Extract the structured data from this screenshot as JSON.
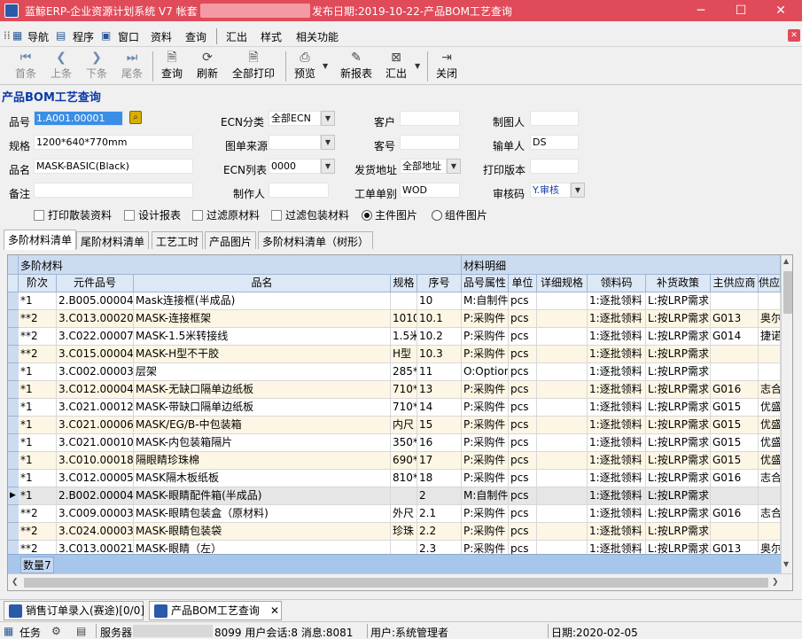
{
  "window": {
    "title_left": "蓝鲸ERP-企业资源计划系统 V7 帐套",
    "title_right": "发布日期:2019-10-22-产品BOM工艺查询",
    "minimize": "─",
    "maximize": "☐",
    "close": "✕"
  },
  "menu": {
    "items": [
      "导航",
      "程序",
      "窗口",
      "资料",
      "查询",
      "汇出",
      "样式",
      "相关功能"
    ]
  },
  "toolbar": {
    "first": "首条",
    "prev": "上条",
    "next": "下条",
    "last": "尾条",
    "query": "查询",
    "refresh": "刷新",
    "print_all": "全部打印",
    "preview": "预览",
    "new_report": "新报表",
    "export": "汇出",
    "close": "关闭"
  },
  "form": {
    "title": "产品BOM工艺查询",
    "item_no_label": "品号",
    "item_no": "1.A001.00001",
    "spec_label": "规格",
    "spec": "1200*640*770mm",
    "name_label": "品名",
    "name": "MASK-BASIC(Black)",
    "remark_label": "备注",
    "remark": "",
    "ecn_class_label": "ECN分类",
    "ecn_class": "全部ECN",
    "drawing_source_label": "图单来源",
    "drawing_source": "",
    "ecn_list_label": "ECN列表",
    "ecn_list": "0000",
    "maker_label": "制作人",
    "maker": "",
    "customer_label": "客户",
    "customer": "",
    "customer_no_label": "客号",
    "customer_no": "",
    "ship_addr_label": "发货地址",
    "ship_addr": "全部地址",
    "work_order_label": "工单单别",
    "work_order": "WOD",
    "chart_maker_label": "制图人",
    "chart_maker": "",
    "input_by_label": "输单人",
    "input_by": "DS",
    "print_version_label": "打印版本",
    "print_version": "",
    "review_code_label": "审核码",
    "review_code": "Y.审核",
    "chk_print_bulk": "打印散装资料",
    "chk_design_report": "设计报表",
    "chk_filter_raw": "过滤原材料",
    "chk_filter_pack": "过滤包装材料",
    "radio_main_image": "主件图片",
    "radio_comp_image": "组件图片"
  },
  "tabs": [
    "多阶材料清单",
    "尾阶材料清单",
    "工艺工时",
    "产品图片",
    "多阶材料清单（树形）"
  ],
  "grid": {
    "group1": "多阶材料",
    "group2": "材料明细",
    "headers": [
      "阶次",
      "元件品号",
      "品名",
      "规格",
      "序号",
      "品号属性",
      "单位",
      "详细规格",
      "领料码",
      "补货政策",
      "主供应商",
      "供应"
    ],
    "rows": [
      [
        "*1",
        "2.B005.00004",
        "Mask连接框(半成品)",
        "",
        "10",
        "M:自制件",
        "pcs",
        "",
        "1:逐批领料",
        "L:按LRP需求",
        "",
        ""
      ],
      [
        "**2",
        "3.C013.00020",
        "MASK-连接框架",
        "1010",
        "10.1",
        "P:采购件",
        "pcs",
        "",
        "1:逐批领料",
        "L:按LRP需求",
        "G013",
        "奥尔"
      ],
      [
        "**2",
        "3.C022.00007",
        "MASK-1.5米转接线",
        "1.5米",
        "10.2",
        "P:采购件",
        "pcs",
        "",
        "1:逐批领料",
        "L:按LRP需求",
        "G014",
        "捷诺"
      ],
      [
        "**2",
        "3.C015.00004",
        "MASK-H型不干胶",
        "H型",
        "10.3",
        "P:采购件",
        "pcs",
        "",
        "1:逐批领料",
        "L:按LRP需求",
        "",
        ""
      ],
      [
        "*1",
        "3.C002.00003",
        "层架",
        "285*",
        "11",
        "O:Option",
        "pcs",
        "",
        "1:逐批领料",
        "L:按LRP需求",
        "",
        ""
      ],
      [
        "*1",
        "3.C012.00004",
        "MASK-无缺口隔单边纸板",
        "710*",
        "13",
        "P:采购件",
        "pcs",
        "",
        "1:逐批领料",
        "L:按LRP需求",
        "G016",
        "志合"
      ],
      [
        "*1",
        "3.C021.00012",
        "MASK-带缺口隔单边纸板",
        "710*",
        "14",
        "P:采购件",
        "pcs",
        "",
        "1:逐批领料",
        "L:按LRP需求",
        "G015",
        "优盛"
      ],
      [
        "*1",
        "3.C021.00006",
        "MASK/EG/B-中包装箱",
        "内尺",
        "15",
        "P:采购件",
        "pcs",
        "",
        "1:逐批领料",
        "L:按LRP需求",
        "G015",
        "优盛"
      ],
      [
        "*1",
        "3.C021.00010",
        "MASK-内包装箱隔片",
        "350*",
        "16",
        "P:采购件",
        "pcs",
        "",
        "1:逐批领料",
        "L:按LRP需求",
        "G015",
        "优盛"
      ],
      [
        "*1",
        "3.C010.00018",
        "隔眼睛珍珠棉",
        "690*",
        "17",
        "P:采购件",
        "pcs",
        "",
        "1:逐批领料",
        "L:按LRP需求",
        "G015",
        "优盛"
      ],
      [
        "*1",
        "3.C012.00005",
        "MASK隔木板纸板",
        "810*",
        "18",
        "P:采购件",
        "pcs",
        "",
        "1:逐批领料",
        "L:按LRP需求",
        "G016",
        "志合"
      ],
      [
        "*1",
        "2.B002.00004",
        "MASK-眼睛配件箱(半成品)",
        "",
        "2",
        "M:自制件",
        "pcs",
        "",
        "1:逐批领料",
        "L:按LRP需求",
        "",
        ""
      ],
      [
        "**2",
        "3.C009.00003",
        "MASK-眼睛包装盒（原材料)",
        "外尺",
        "2.1",
        "P:采购件",
        "pcs",
        "",
        "1:逐批领料",
        "L:按LRP需求",
        "G016",
        "志合"
      ],
      [
        "**2",
        "3.C024.00003",
        "MASK-眼睛包装袋",
        "珍珠",
        "2.2",
        "P:采购件",
        "pcs",
        "",
        "1:逐批领料",
        "L:按LRP需求",
        "",
        ""
      ],
      [
        "**2",
        "3.C013.00021",
        "MASK-眼睛（左）",
        "",
        "2.3",
        "P:采购件",
        "pcs",
        "",
        "1:逐批领料",
        "L:按LRP需求",
        "G013",
        "奥尔"
      ]
    ],
    "current_row_marker": "▶",
    "count_label": "数量7"
  },
  "doctabs": [
    "销售订单录入(赛途)[0/0]",
    "产品BOM工艺查询"
  ],
  "status": {
    "task": "任务",
    "server": "服务器:",
    "server_info": "8099 用户会话:8 消息:8081",
    "user": "用户:系统管理者",
    "date": "日期:2020-02-05"
  },
  "colors": {
    "titlebar": "#e04b5a",
    "grid_header": "#ccdcf0",
    "row_alt": "#fdf6e4",
    "selected_row": "#e6e6e6",
    "count_bar": "#a8c6ec"
  }
}
